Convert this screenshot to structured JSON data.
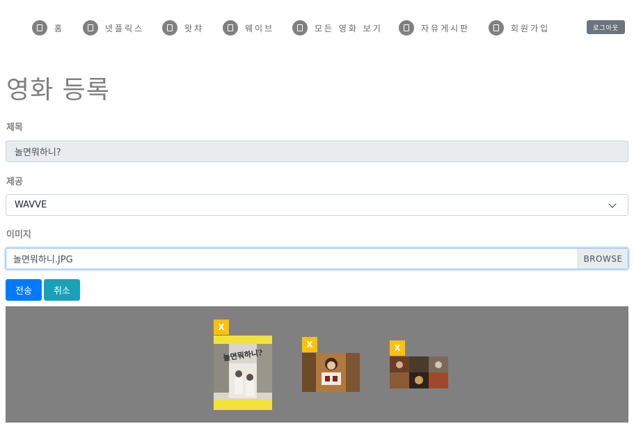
{
  "nav": {
    "items": [
      {
        "label": "홈"
      },
      {
        "label": "넷플릭스"
      },
      {
        "label": "왓챠"
      },
      {
        "label": "웨이브"
      },
      {
        "label": "모든 영화 보기"
      },
      {
        "label": "자유게시판"
      },
      {
        "label": "회원가입"
      }
    ],
    "logout_label": "로그아웃"
  },
  "page": {
    "title": "영화 등록"
  },
  "form": {
    "title_label": "제목",
    "title_value": "놀면뭐하니?",
    "provider_label": "제공",
    "provider_value": "WAVVE",
    "image_label": "이미지",
    "image_file": "놀면뭐하니.JPG",
    "browse_label": "BROWSE",
    "submit_label": "전송",
    "cancel_label": "취소"
  },
  "preview": {
    "remove_label": "X",
    "poster_title": "놀면뭐하니?"
  },
  "colors": {
    "nav_icon": "#808080",
    "primary": "#007bff",
    "info": "#17a2b8",
    "warning": "#ffc107",
    "secondary": "#6c757d",
    "preview_bg": "#808080"
  }
}
